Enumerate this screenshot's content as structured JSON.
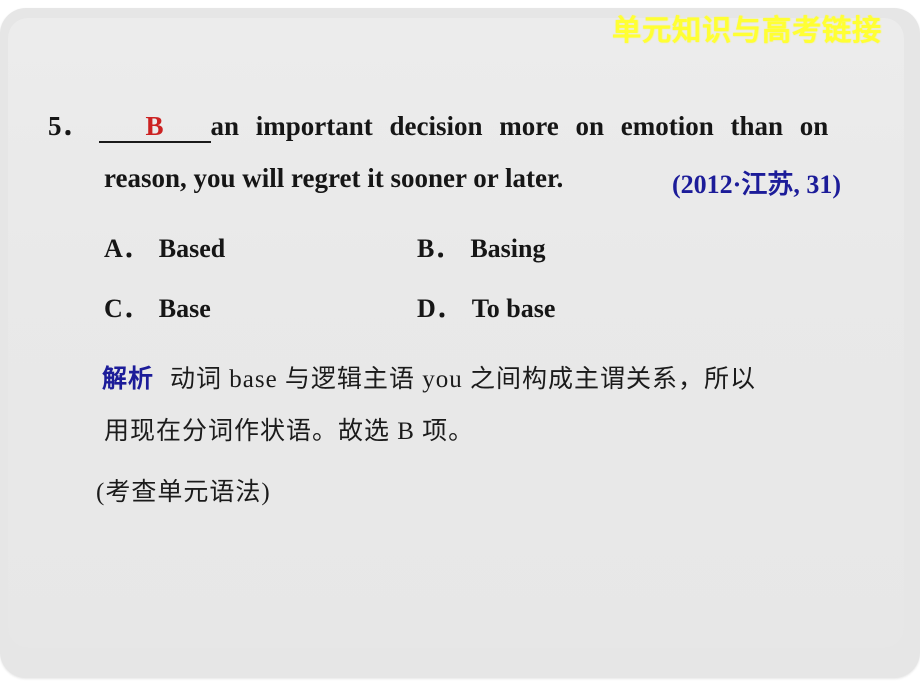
{
  "banner": {
    "title": "单元知识与高考链接",
    "color": "#ffff33"
  },
  "question": {
    "number": "5．",
    "answer": "B",
    "stem_part1": "an important decision more on emotion than on",
    "stem_part2": "reason, you will regret it sooner or later.",
    "source": "(2012·江苏, 31)",
    "source_color": "#1c1c99"
  },
  "options": [
    {
      "label": "A．",
      "text": "Based"
    },
    {
      "label": "B．",
      "text": "Basing"
    },
    {
      "label": "C．",
      "text": "Base"
    },
    {
      "label": "D．",
      "text": "To base"
    }
  ],
  "analysis": {
    "tag": "解析",
    "line1": "动词 base 与逻辑主语 you 之间构成主谓关系，所以",
    "line2": "用现在分词作状语。故选 B 项。"
  },
  "footnote": "(考查单元语法)",
  "colors": {
    "answer_red": "#cc2222",
    "accent_blue": "#1c1c99",
    "text_black": "#161616",
    "page_bg": "#e9e9e9"
  }
}
